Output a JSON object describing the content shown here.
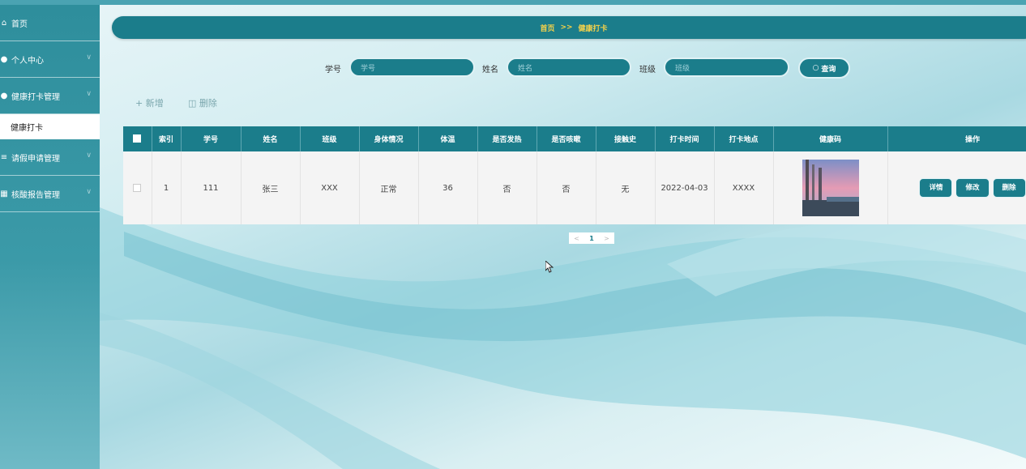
{
  "sidebar": {
    "items": [
      {
        "icon": "home-icon",
        "label": "首页",
        "has_arrow": false
      },
      {
        "icon": "user-icon",
        "label": "个人中心",
        "has_arrow": true
      },
      {
        "icon": "pin-icon",
        "label": "健康打卡管理",
        "has_arrow": true
      },
      {
        "icon": "list-icon",
        "label": "请假申请管理",
        "has_arrow": true
      },
      {
        "icon": "grid-icon",
        "label": "核酸报告管理",
        "has_arrow": true
      }
    ],
    "subitem": "健康打卡"
  },
  "breadcrumb": {
    "home": "首页",
    "separator": ">>",
    "current": "健康打卡"
  },
  "search": {
    "student_id_label": "学号",
    "student_id_placeholder": "学号",
    "name_label": "姓名",
    "name_placeholder": "姓名",
    "class_label": "班级",
    "class_placeholder": "班级",
    "query_label": "查询"
  },
  "actions": {
    "add": "+ 新增",
    "delete": "删除"
  },
  "table": {
    "headers": [
      "索引",
      "学号",
      "姓名",
      "班级",
      "身体情况",
      "体温",
      "是否发热",
      "是否咳嗽",
      "接触史",
      "打卡时间",
      "打卡地点",
      "健康码",
      "操作"
    ],
    "rows": [
      {
        "index": "1",
        "student_id": "111",
        "name": "张三",
        "class": "XXX",
        "condition": "正常",
        "temperature": "36",
        "fever": "否",
        "cough": "否",
        "contact": "无",
        "time": "2022-04-03",
        "location": "XXXX"
      }
    ],
    "row_buttons": {
      "detail": "详情",
      "edit": "修改",
      "delete": "删除"
    }
  },
  "pagination": {
    "prev": "<",
    "page": "1",
    "next": ">"
  },
  "colors": {
    "primary": "#1b7d8b",
    "breadcrumb_text": "#f5d24a",
    "sidebar": "#3b9aa8"
  }
}
